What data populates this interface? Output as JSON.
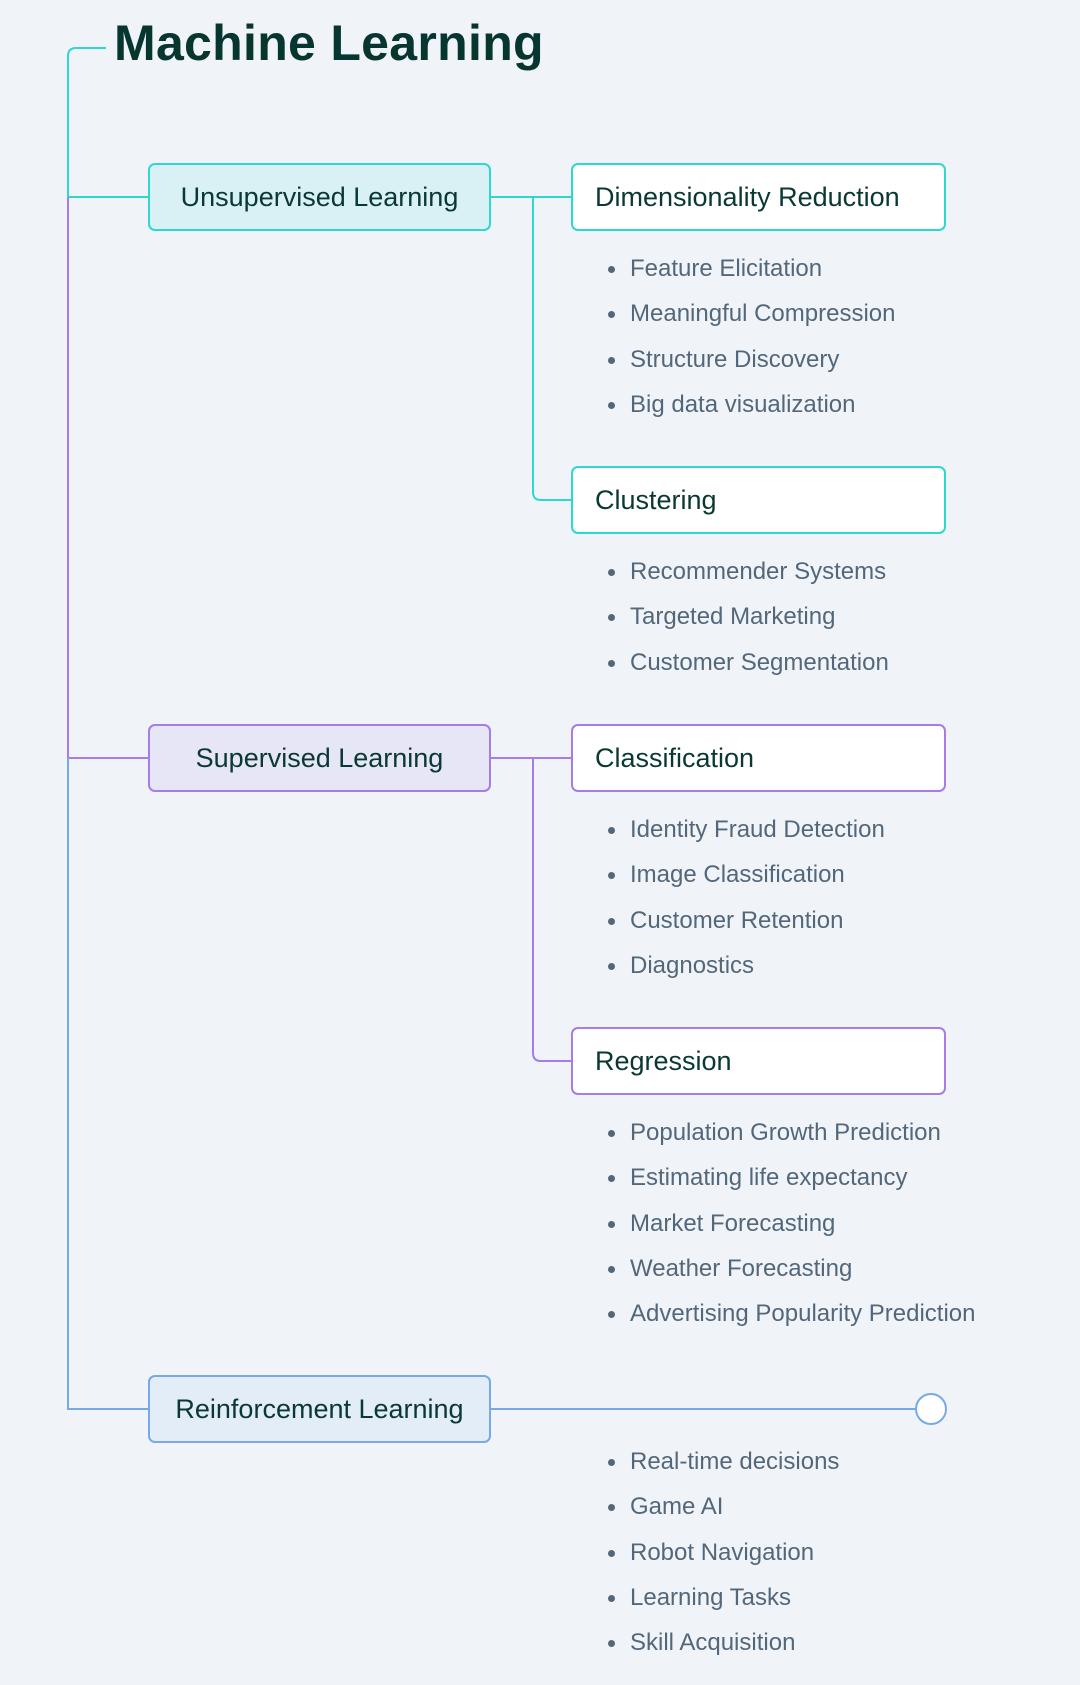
{
  "title": "Machine Learning",
  "colors": {
    "unsupervised": "#2ed8cf",
    "supervised": "#a57ce8",
    "reinforcement": "#77a9e8",
    "text_dark": "#0a3833",
    "text_muted": "#53677b",
    "background": "#f0f4f9"
  },
  "branches": [
    {
      "label": "Unsupervised Learning",
      "children": [
        {
          "label": "Dimensionality Reduction",
          "items": [
            "Feature Elicitation",
            "Meaningful Compression",
            "Structure Discovery",
            "Big data visualization"
          ]
        },
        {
          "label": "Clustering",
          "items": [
            "Recommender Systems",
            "Targeted Marketing",
            "Customer Segmentation"
          ]
        }
      ]
    },
    {
      "label": "Supervised Learning",
      "children": [
        {
          "label": "Classification",
          "items": [
            "Identity Fraud Detection",
            "Image Classification",
            "Customer Retention",
            "Diagnostics"
          ]
        },
        {
          "label": "Regression",
          "items": [
            "Population Growth Prediction",
            "Estimating life expectancy",
            "Market Forecasting",
            "Weather Forecasting",
            "Advertising Popularity Prediction"
          ]
        }
      ]
    },
    {
      "label": "Reinforcement Learning",
      "items": [
        "Real-time decisions",
        "Game AI",
        "Robot Navigation",
        "Learning Tasks",
        "Skill Acquisition"
      ]
    }
  ]
}
